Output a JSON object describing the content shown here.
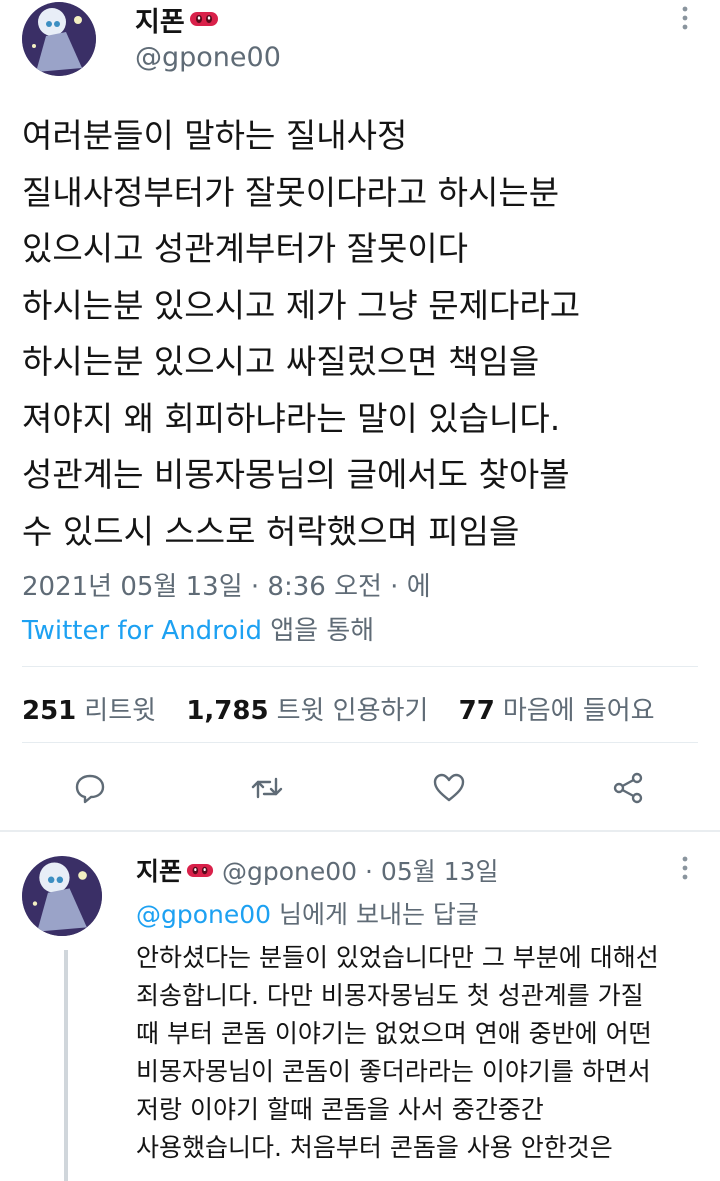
{
  "tweet": {
    "author_name": "지폰",
    "author_handle": "@gpone00",
    "more_icon": "more-vertical-icon",
    "body_lines": [
      "여러분들이 말하는 질내사정",
      "질내사정부터가 잘못이다라고 하시는분",
      "있으시고 성관계부터가 잘못이다",
      "하시는분 있으시고 제가 그냥 문제다라고",
      "하시는분 있으시고 싸질렀으면 책임을",
      "져야지 왜 회피하냐라는 말이 있습니다.",
      "성관계는 비몽자몽님의 글에서도 찾아볼",
      "수 있드시 스스로 허락했으며 피임을"
    ],
    "timestamp": "2021년 05월 13일 · 8:36 오전 · 에",
    "source_app": "Twitter for Android",
    "source_suffix": " 앱을 통해",
    "stats": {
      "retweets_count": "251",
      "retweets_label": "리트윗",
      "quotes_count": "1,785",
      "quotes_label": "트윗 인용하기",
      "likes_count": "77",
      "likes_label": "마음에 들어요"
    },
    "actions": [
      "reply-icon",
      "retweet-icon",
      "like-icon",
      "share-icon"
    ]
  },
  "reply": {
    "author_name": "지폰",
    "handle_date": "@gpone00 · 05월 13일",
    "reply_to_handle": "@gpone00",
    "reply_to_suffix": " 님에게 보내는 답글",
    "body_lines": [
      "안하셨다는 분들이 있었습니다만 그 부분에 대해선",
      "죄송합니다. 다만 비몽자몽님도 첫 성관계를 가질",
      "때 부터 콘돔 이야기는 없었으며 연애 중반에 어떤",
      "비몽자몽님이 콘돔이 좋더라라는 이야기를 하면서",
      "저랑 이야기 할때 콘돔을 사서 중간중간",
      "사용했습니다. 처음부터 콘돔을 사용 안한것은"
    ]
  },
  "colors": {
    "link": "#1da1f2",
    "secondary_text": "#5f6b76",
    "divider": "#e6ecf0",
    "mask_badge": "#d9214a"
  }
}
